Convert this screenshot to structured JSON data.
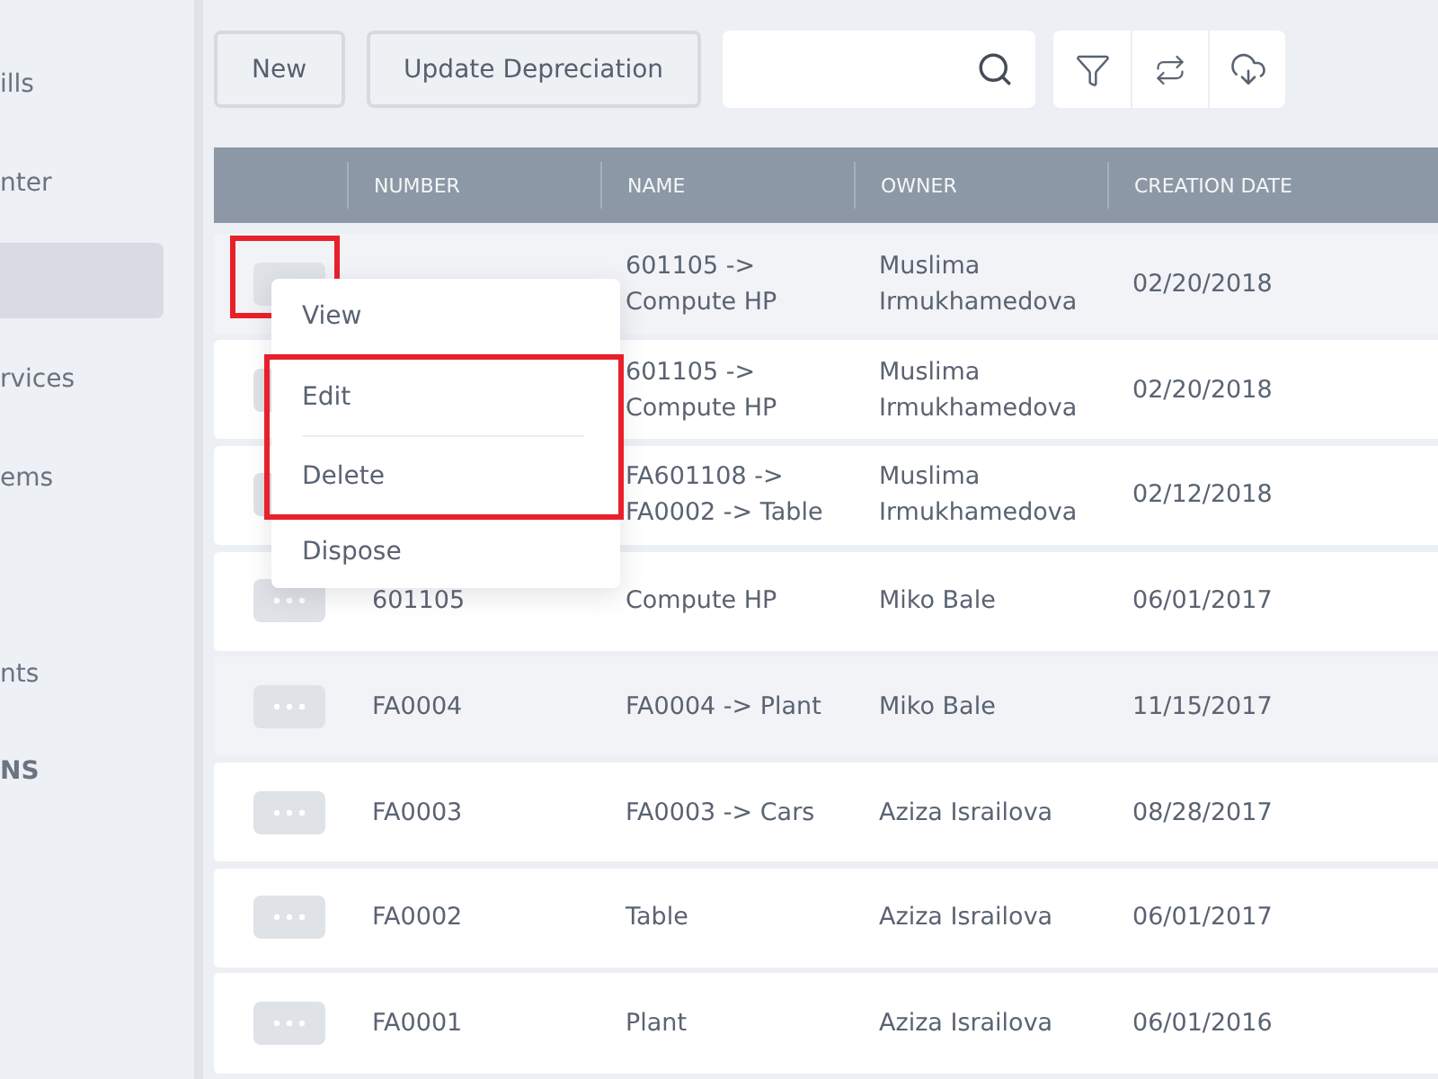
{
  "sidebar": {
    "items": [
      {
        "kind": "link",
        "label": "ills",
        "selected": false
      },
      {
        "kind": "link",
        "label": "nter",
        "selected": false
      },
      {
        "kind": "link",
        "selected": true
      },
      {
        "kind": "link",
        "label": "rvices",
        "selected": false
      },
      {
        "kind": "link",
        "label": "ems",
        "selected": false
      },
      {
        "kind": "spacer"
      },
      {
        "kind": "link",
        "label": "nts",
        "selected": false
      },
      {
        "kind": "heading",
        "label": "NS"
      }
    ]
  },
  "toolbar": {
    "buttons": [
      "New",
      "Update Depreciation"
    ]
  },
  "table": {
    "columns": [
      "NUMBER",
      "NAME",
      "OWNER",
      "CREATION DATE"
    ],
    "rows": [
      {
        "highlighted": true,
        "cells": [
          "",
          "601105 -> Compute HP",
          "Muslima Irmukhamedova",
          "02/20/2018"
        ]
      },
      {
        "highlighted": false,
        "cells": [
          "",
          "601105 -> Compute HP",
          "Muslima Irmukhamedova",
          "02/20/2018"
        ]
      },
      {
        "highlighted": false,
        "cells": [
          "",
          "FA601108 -> FA0002 -> Table",
          "Muslima Irmukhamedova",
          "02/12/2018"
        ]
      },
      {
        "highlighted": false,
        "cells": [
          "601105",
          "Compute HP",
          "Miko Bale",
          "06/01/2017"
        ]
      },
      {
        "highlighted": true,
        "cells": [
          "FA0004",
          "FA0004 -> Plant",
          "Miko Bale",
          "11/15/2017"
        ]
      },
      {
        "highlighted": false,
        "cells": [
          "FA0003",
          "FA0003 -> Cars",
          "Aziza Israilova",
          "08/28/2017"
        ]
      },
      {
        "highlighted": false,
        "cells": [
          "FA0002",
          "Table",
          "Aziza Israilova",
          "06/01/2017"
        ]
      },
      {
        "highlighted": false,
        "cells": [
          "FA0001",
          "Plant",
          "Aziza Israilova",
          "06/01/2016"
        ]
      }
    ]
  },
  "context_menu": {
    "items": [
      "View",
      "Edit",
      "Delete",
      "Dispose"
    ]
  }
}
